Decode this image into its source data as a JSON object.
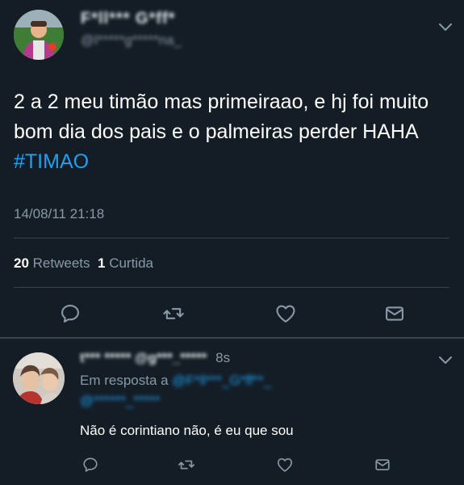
{
  "tweet": {
    "display_name": "F*ll*** G*ff*",
    "handle": "@l*****g*****na_",
    "text_part1": "2 a 2 meu timão mas primeiraao, e hj foi muito bom dia dos pais e o palmeiras perder HAHA ",
    "hashtag": "#TIMAO",
    "timestamp": "14/08/11 21:18",
    "retweet_count": "20",
    "retweet_label": "Retweets",
    "like_count": "1",
    "like_label": "Curtida",
    "icons": [
      "reply-icon",
      "retweet-icon",
      "heart-icon",
      "message-icon",
      "chevron-down-icon"
    ]
  },
  "reply": {
    "name_and_handle": "t*** ***** @g***_*****",
    "time": "8s",
    "in_reply_label": "Em resposta a",
    "in_reply_mentions_line1": "@F*ll***_G*ff**_",
    "in_reply_mentions_line2": "@******_*****",
    "text": "Não é corintiano não, é eu que sou"
  },
  "colors": {
    "background": "#141d26",
    "text": "#ffffff",
    "secondary": "#8899a6",
    "link": "#1da1f2",
    "divider": "#38444d"
  }
}
